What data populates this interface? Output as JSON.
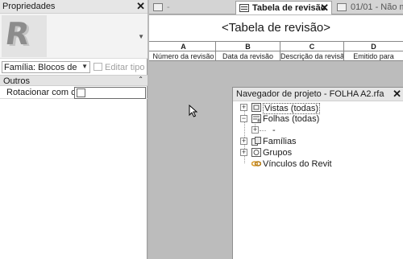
{
  "properties": {
    "title": "Propriedades",
    "family_value": "Família: Blocos de m",
    "edit_type_label": "Editar tipo",
    "group_label": "Outros",
    "rows": [
      {
        "label": "Rotacionar com c..."
      }
    ]
  },
  "tabs": [
    {
      "label": "-",
      "icon": "drawing-sheet-icon",
      "active": false
    },
    {
      "label": "Tabela de revisão",
      "icon": "schedule-table-icon",
      "active": true
    },
    {
      "label": "01/01 - Não m",
      "icon": "sheet-icon",
      "active": false
    }
  ],
  "schedule": {
    "title": "<Tabela de revisão>",
    "column_letters": [
      "A",
      "B",
      "C",
      "D"
    ],
    "column_headers": [
      "Número da revisão",
      "Data da revisão",
      "Descrição da revisã",
      "Emitido para"
    ]
  },
  "browser": {
    "title": "Navegador de projeto - FOLHA A2.rfa",
    "nodes": [
      {
        "label": "Vistas (todas)",
        "icon": "views-icon"
      },
      {
        "label": "Folhas (todas)",
        "icon": "sheets-icon"
      },
      {
        "label": "-",
        "icon": "sheet-icon"
      },
      {
        "label": "Famílias",
        "icon": "families-icon"
      },
      {
        "label": "Grupos",
        "icon": "groups-icon"
      },
      {
        "label": "Vínculos do Revit",
        "icon": "link-icon"
      }
    ]
  },
  "colors": {
    "canvas_gray": "#bcbcbc",
    "panel_header": "#e6e6e6",
    "link_orange": "#d89a2c"
  }
}
